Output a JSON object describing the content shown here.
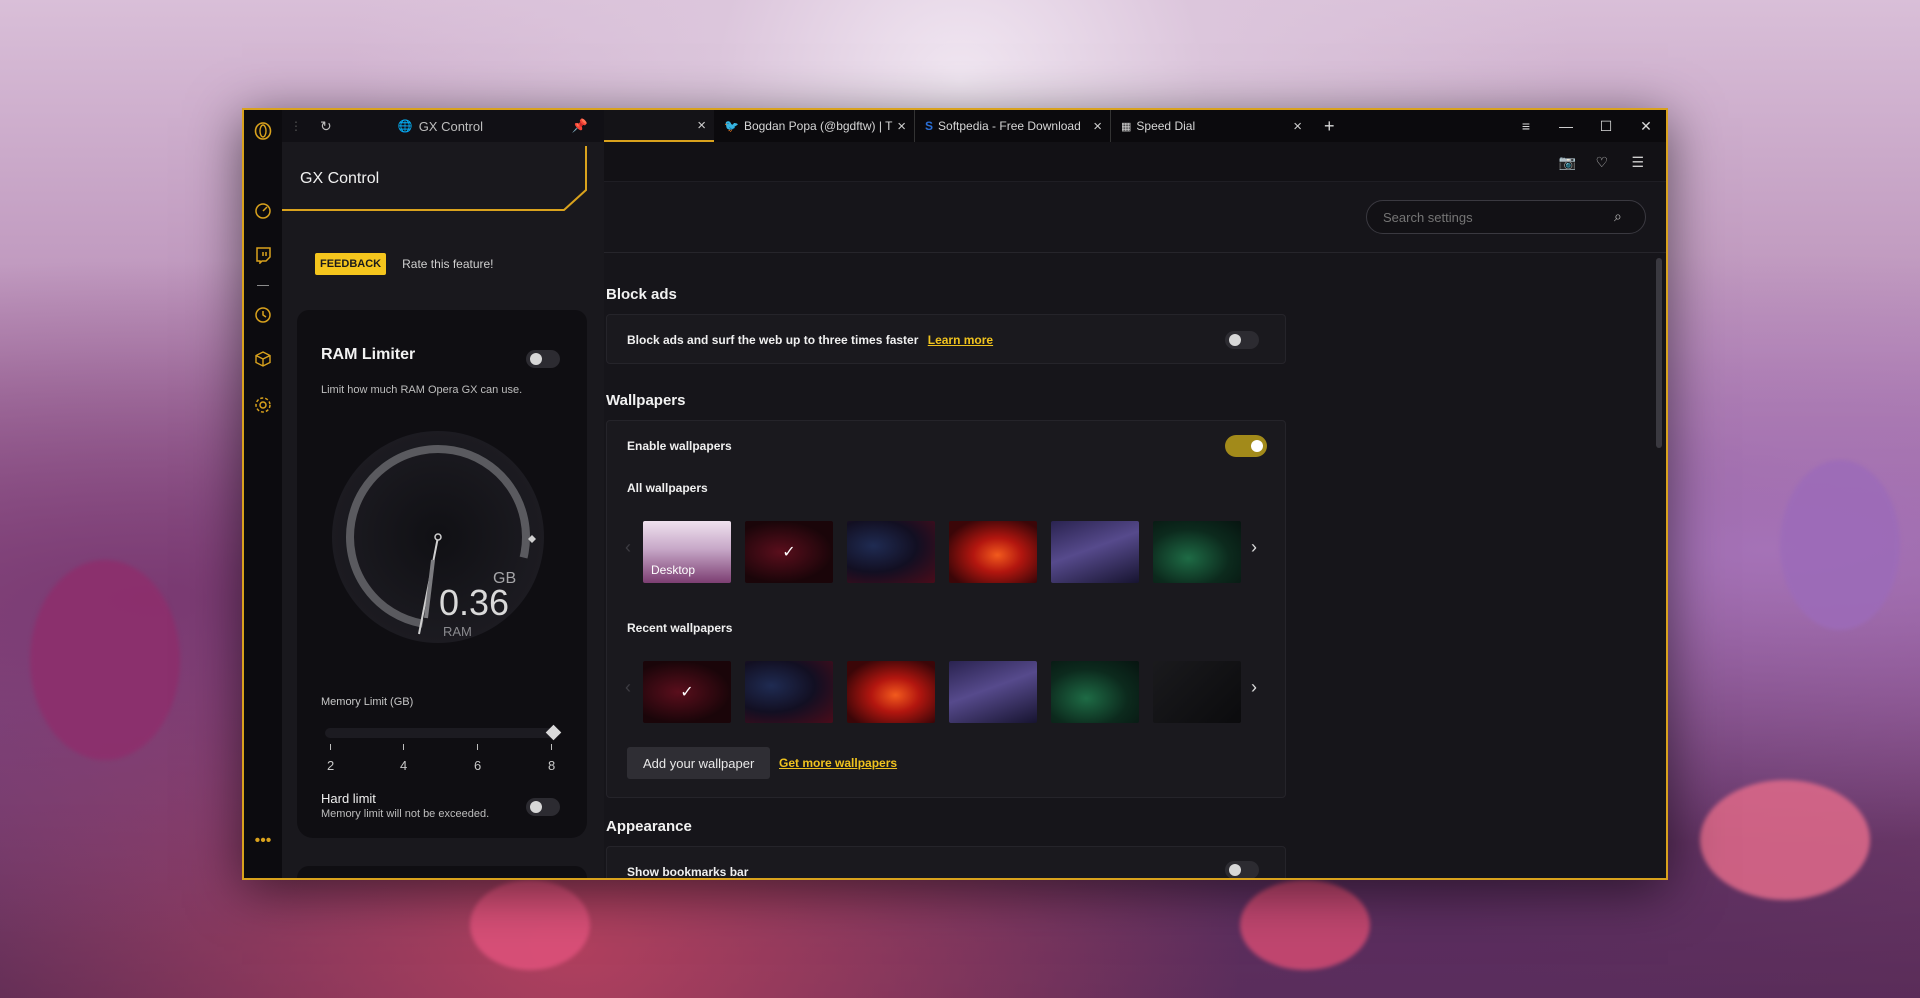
{
  "panel": {
    "tab_label": "GX Control",
    "title": "GX Control",
    "feedback_badge": "FEEDBACK",
    "feedback_text": "Rate this feature!",
    "ram": {
      "title": "RAM Limiter",
      "description": "Limit how much RAM Opera GX can use.",
      "enabled": false,
      "value": "0.36",
      "unit": "GB",
      "sub_label": "RAM",
      "memory_limit_label": "Memory Limit (GB)",
      "ticks": [
        "2",
        "4",
        "6",
        "8"
      ],
      "slider_value": 8,
      "hard_limit_title": "Hard limit",
      "hard_limit_desc": "Memory limit will not be exceeded.",
      "hard_limit_enabled": false
    }
  },
  "tabs": [
    {
      "label": "",
      "active": true
    },
    {
      "label": "Bogdan Popa (@bgdftw) | T",
      "icon": "twitter-icon"
    },
    {
      "label": "Softpedia - Free Download",
      "icon": "softpedia-icon"
    },
    {
      "label": "Speed Dial",
      "icon": "speed-dial-icon"
    }
  ],
  "settings": {
    "search_placeholder": "Search settings",
    "block_ads": {
      "section": "Block ads",
      "text": "Block ads and surf the web up to three times faster",
      "link": "Learn more",
      "enabled": false
    },
    "wallpapers": {
      "section": "Wallpapers",
      "enable_label": "Enable wallpapers",
      "enabled": true,
      "all_label": "All wallpapers",
      "desktop_label": "Desktop",
      "recent_label": "Recent wallpapers",
      "add_button": "Add your wallpaper",
      "more_link": "Get more wallpapers"
    },
    "appearance": {
      "section": "Appearance",
      "bookmarks_label": "Show bookmarks bar",
      "bookmarks_enabled": false
    }
  },
  "colors": {
    "accent": "#d9a21d",
    "link": "#f0c31e"
  }
}
